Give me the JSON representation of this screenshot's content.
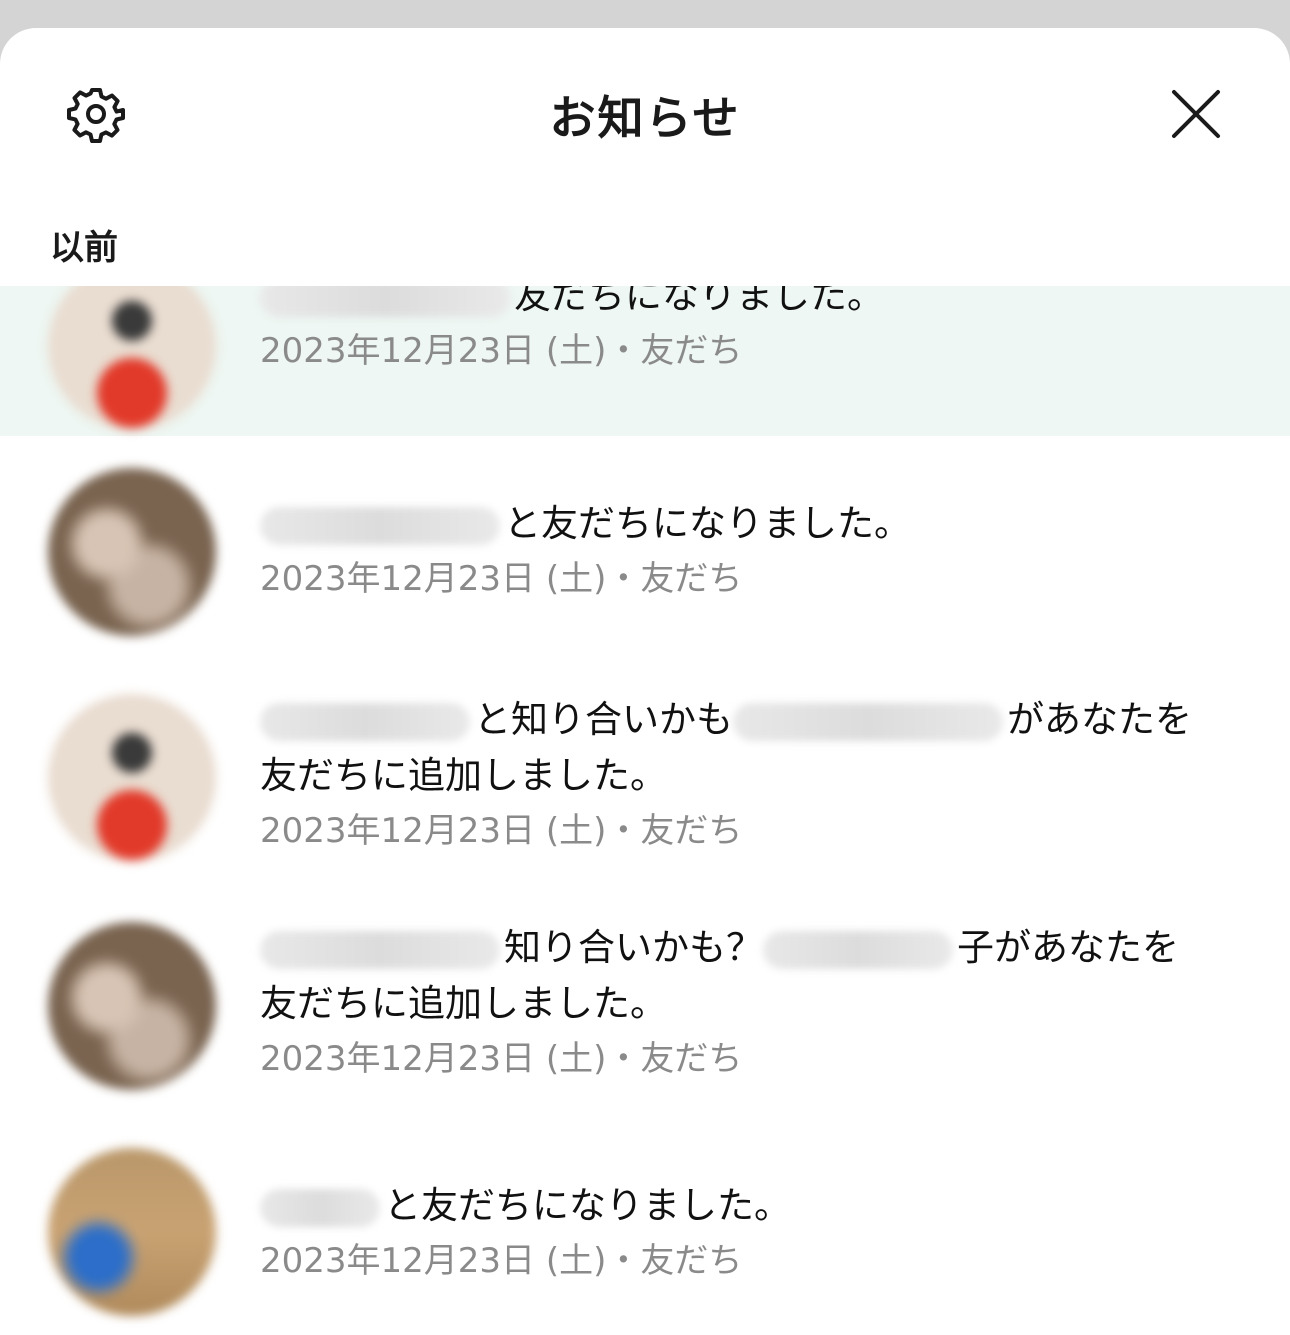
{
  "header": {
    "title": "お知らせ",
    "settings_icon": "gear-icon",
    "close_icon": "close-icon"
  },
  "section": {
    "label": "以前"
  },
  "notifications": [
    {
      "message": "友だちになりました。",
      "date": "2023年12月23日 (土)",
      "separator": "・",
      "category": "友だち"
    },
    {
      "message": "と友だちになりました。",
      "date": "2023年12月23日 (土)",
      "separator": "・",
      "category": "友だち"
    },
    {
      "message_part1": "と知り合いかも",
      "message_part2": "があなたを",
      "message_line2": "友だちに追加しました。",
      "date": "2023年12月23日 (土)",
      "separator": "・",
      "category": "友だち"
    },
    {
      "message_part1": "知り合いかも？",
      "message_part2": "子があなたを",
      "message_line2": "友だちに追加しました。",
      "date": "2023年12月23日 (土)",
      "separator": "・",
      "category": "友だち"
    },
    {
      "message": "と友だちになりました。",
      "date": "2023年12月23日 (土)",
      "separator": "・",
      "category": "友だち"
    }
  ],
  "colors": {
    "highlight_row": "#eef7f3",
    "meta_text": "#8a8a8a",
    "title_text": "#1a1a1a"
  }
}
